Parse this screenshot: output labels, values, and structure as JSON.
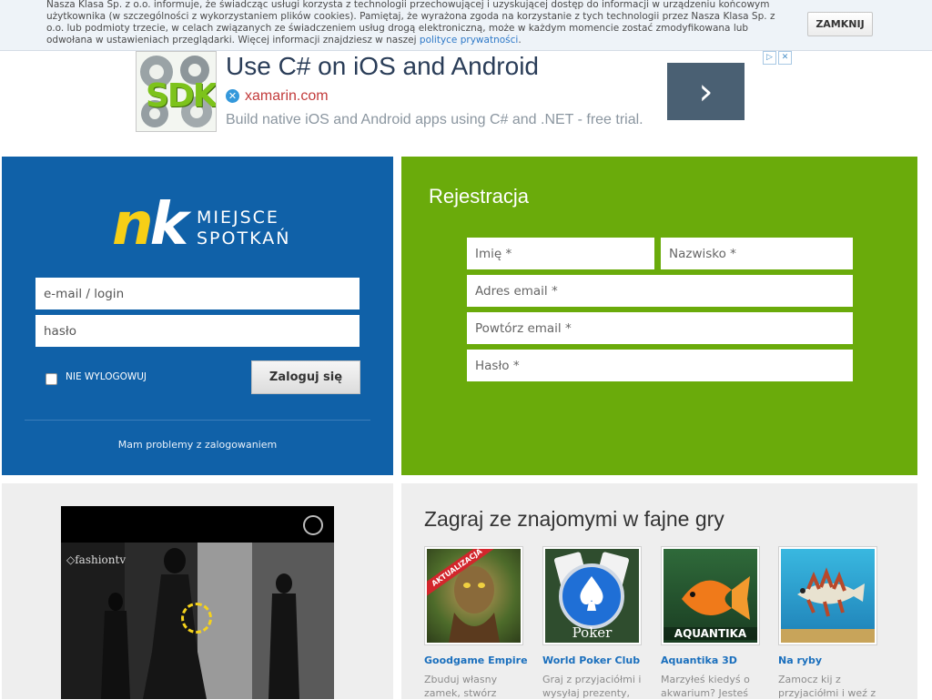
{
  "cookie_bar": {
    "text": "Nasza Klasa Sp. z o.o. informuje, że świadcząc usługi korzysta z technologii przechowującej i uzyskującej dostęp do informacji w urządzeniu końcowym użytkownika (w szczególności z wykorzystaniem plików cookies). Pamiętaj, że wyrażona zgoda na korzystanie z tych technologii przez Nasza Klasa Sp. z o.o. lub podmioty trzecie, w celach związanych ze świadczeniem usług drogą elektroniczną, może w każdym momencie zostać zmodyfikowana lub odwołana w ustawieniach przeglądarki. Więcej informacji znajdziesz w naszej",
    "link_text": "polityce prywatności",
    "close_label": "ZAMKNIJ"
  },
  "ad": {
    "thumb_text": "SDK",
    "title": "Use C# on iOS and Android",
    "domain": "xamarin.com",
    "description": "Build native iOS and Android apps using C# and .NET - free trial.",
    "arrow": "›",
    "badges": [
      "▷",
      "✕"
    ]
  },
  "login": {
    "logo_n": "n",
    "logo_k": "k",
    "logo_line1": "MIEJSCE",
    "logo_line2": "SPOTKAŃ",
    "email_placeholder": "e-mail / login",
    "password_placeholder": "hasło",
    "remember_label": "NIE WYLOGOWUJ",
    "submit_label": "Zaloguj się",
    "problems_link": "Mam problemy z zalogowaniem"
  },
  "registration": {
    "title": "Rejestracja",
    "first_name": "Imię *",
    "last_name": "Nazwisko *",
    "email": "Adres email *",
    "email_repeat": "Powtórz email *",
    "password": "Hasło *"
  },
  "video": {
    "brand": "fashiontv"
  },
  "games": {
    "title": "Zagraj ze znajomymi w fajne gry",
    "items": [
      {
        "name": "Goodgame Empire",
        "ribbon": "AKTUALIZACJA",
        "desc1": "Zbuduj własny",
        "desc2": "zamek, stwórz"
      },
      {
        "name": "World Poker Club",
        "thumb_label": "Poker",
        "desc1": "Graj z przyjaciółmi i",
        "desc2": "wysyłaj prezenty,"
      },
      {
        "name": "Aquantika 3D",
        "thumb_label": "AQUANTIKA",
        "desc1": "Marzyłeś kiedyś o",
        "desc2": "akwarium? Jesteś"
      },
      {
        "name": "Na ryby",
        "desc1": "Zamocz kij z",
        "desc2": "przyjaciółmi i weź z"
      }
    ]
  }
}
